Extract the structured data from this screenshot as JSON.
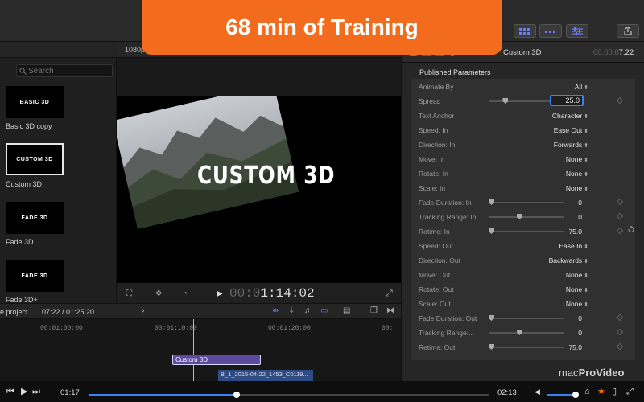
{
  "banner": {
    "text": "68 min of Training"
  },
  "browser": {
    "search_placeholder": "Search",
    "items": [
      {
        "thumb_text": "BASIC 3D",
        "label": "Basic 3D copy"
      },
      {
        "thumb_text": "CUSTOM 3D",
        "label": "Custom 3D"
      },
      {
        "thumb_text": "FADE 3D",
        "label": "Fade 3D"
      },
      {
        "thumb_text": "FADE 3D",
        "label": "Fade 3D+"
      }
    ]
  },
  "viewer": {
    "format_label": "1080p",
    "overlay_title": "CUSTOM 3D",
    "timecode_dim": "00:0",
    "timecode": "1:14:02"
  },
  "inspector": {
    "title": "Custom 3D",
    "time_dim": "00:00:0",
    "time": "7:22",
    "section": "Published Parameters",
    "params": [
      {
        "label": "Animate By",
        "value": "All",
        "kind": "popup"
      },
      {
        "label": "Spread",
        "value": "25.0",
        "kind": "field",
        "slider": 0.2
      },
      {
        "label": "Text Anchor",
        "value": "Character",
        "kind": "popup"
      },
      {
        "label": "Speed: In",
        "value": "Ease Out",
        "kind": "popup"
      },
      {
        "label": "Direction: In",
        "value": "Forwards",
        "kind": "popup"
      },
      {
        "label": "Move: In",
        "value": "None",
        "kind": "popup"
      },
      {
        "label": "Rotate: In",
        "value": "None",
        "kind": "popup"
      },
      {
        "label": "Scale: In",
        "value": "None",
        "kind": "popup"
      },
      {
        "label": "Fade Duration: In",
        "value": "0",
        "kind": "slider",
        "slider": 0.0
      },
      {
        "label": "Tracking Range: In",
        "value": "0",
        "kind": "slider",
        "slider": 0.4
      },
      {
        "label": "Retime: In",
        "value": "75.0",
        "kind": "slider",
        "slider": 0.0
      },
      {
        "label": "Speed: Out",
        "value": "Ease In",
        "kind": "popup"
      },
      {
        "label": "Direction: Out",
        "value": "Backwards",
        "kind": "popup"
      },
      {
        "label": "Move: Out",
        "value": "None",
        "kind": "popup"
      },
      {
        "label": "Rotate: Out",
        "value": "None",
        "kind": "popup"
      },
      {
        "label": "Scale: Out",
        "value": "None",
        "kind": "popup"
      },
      {
        "label": "Fade Duration: Out",
        "value": "0",
        "kind": "slider",
        "slider": 0.0
      },
      {
        "label": "Tracking Range:...",
        "value": "0",
        "kind": "slider",
        "slider": 0.4
      },
      {
        "label": "Retime: Out",
        "value": "75.0",
        "kind": "slider",
        "slider": 0.0
      }
    ]
  },
  "timeline": {
    "project_label": "e project",
    "duration": "07:22 / 01:25:20",
    "ruler": [
      "00:01:00:00",
      "00:01:10:00",
      "00:01:20:00",
      "00:"
    ],
    "clip_title": "Custom 3D",
    "clip_video": "B_1_2015-04-22_1453_C0119..."
  },
  "player": {
    "elapsed": "01:17",
    "remaining": "02:13",
    "progress": 0.37,
    "volume": 1.0,
    "watermark_left": "mac",
    "watermark_right": "ProVideo"
  }
}
